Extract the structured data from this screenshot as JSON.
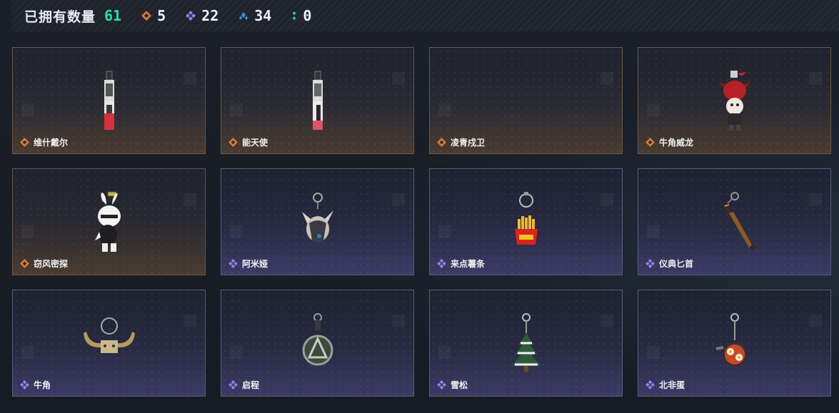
{
  "header": {
    "title": "已拥有数量",
    "total": "61",
    "stats": [
      {
        "icon": "orange-diamond-icon",
        "color": "#d9783c",
        "value": "5"
      },
      {
        "icon": "purple-diamond-icon",
        "color": "#9a7ee8",
        "value": "22"
      },
      {
        "icon": "blue-diamond-icon",
        "color": "#4a8ee0",
        "value": "34"
      },
      {
        "icon": "green-dots-icon",
        "color": "#2fd39a",
        "value": "0"
      }
    ]
  },
  "items": [
    {
      "name": "维什戴尔",
      "rarity": "orange",
      "icon": "keychain-card-charm-icon"
    },
    {
      "name": "能天使",
      "rarity": "orange",
      "icon": "keychain-card-charm-icon"
    },
    {
      "name": "凌青戍卫",
      "rarity": "orange",
      "icon": ""
    },
    {
      "name": "牛角威龙",
      "rarity": "orange",
      "icon": "keychain-figure-charm-icon"
    },
    {
      "name": "窃风密探",
      "rarity": "orange",
      "icon": "keychain-rabbit-figure-icon"
    },
    {
      "name": "阿米娅",
      "rarity": "purple",
      "icon": "keychain-bunny-plush-icon"
    },
    {
      "name": "来点薯条",
      "rarity": "purple",
      "icon": "keychain-fries-icon"
    },
    {
      "name": "仪典匕首",
      "rarity": "purple",
      "icon": "dagger-icon"
    },
    {
      "name": "牛角",
      "rarity": "purple",
      "icon": "horns-icon"
    },
    {
      "name": "启程",
      "rarity": "purple",
      "icon": "keychain-medal-icon"
    },
    {
      "name": "雪松",
      "rarity": "purple",
      "icon": "keychain-pine-tree-icon"
    },
    {
      "name": "北非蛋",
      "rarity": "purple",
      "icon": "keychain-shakshuka-icon"
    }
  ]
}
